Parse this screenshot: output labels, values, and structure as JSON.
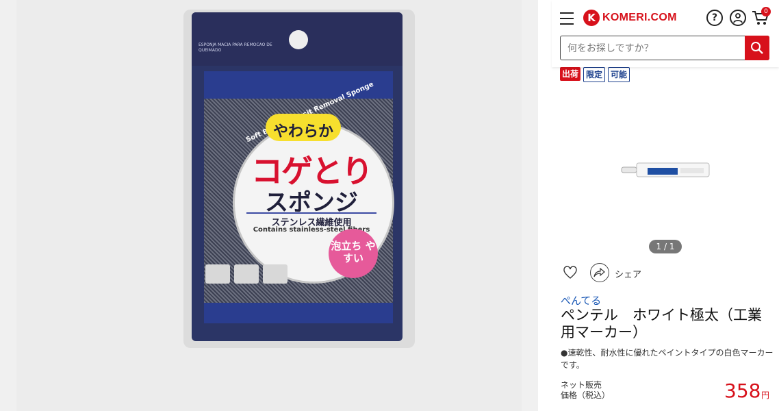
{
  "header": {
    "logo_mark": "K",
    "logo_text": "KOMERI.COM",
    "help_symbol": "?",
    "cart_count": "0",
    "search_placeholder": "何をお探しですか？",
    "icons": [
      "menu-icon",
      "help-icon",
      "user-icon",
      "cart-icon",
      "search-icon"
    ]
  },
  "badges": [
    "出荷",
    "限定",
    "可能"
  ],
  "product_image": {
    "arc_text": "Soft Burnt Deposit Removal Sponge",
    "small_text": "ESPONJA MACIA PARA REMOCAO DE QUEIMADO",
    "yawaraka": "やわらか",
    "koge_tori": "コゲとり",
    "sponge": "スポンジ",
    "stainless": "ステンレス繊維使用",
    "contains": "Contains stainless-steel fibers",
    "awadachi": "泡立ち やすい"
  },
  "pager": "1 / 1",
  "share_label": "シェア",
  "brand": "ぺんてる",
  "title": "ペンテル　ホワイト極太（工業用マーカー）",
  "description": "●速乾性、耐水性に優れたペイントタイプの白色マーカーです。",
  "price": {
    "label_line1": "ネット販売",
    "label_line2": "価格（税込）",
    "value": "358",
    "unit": "円"
  },
  "colors": {
    "brand_red": "#d7111b",
    "link_blue": "#1a58b5"
  }
}
